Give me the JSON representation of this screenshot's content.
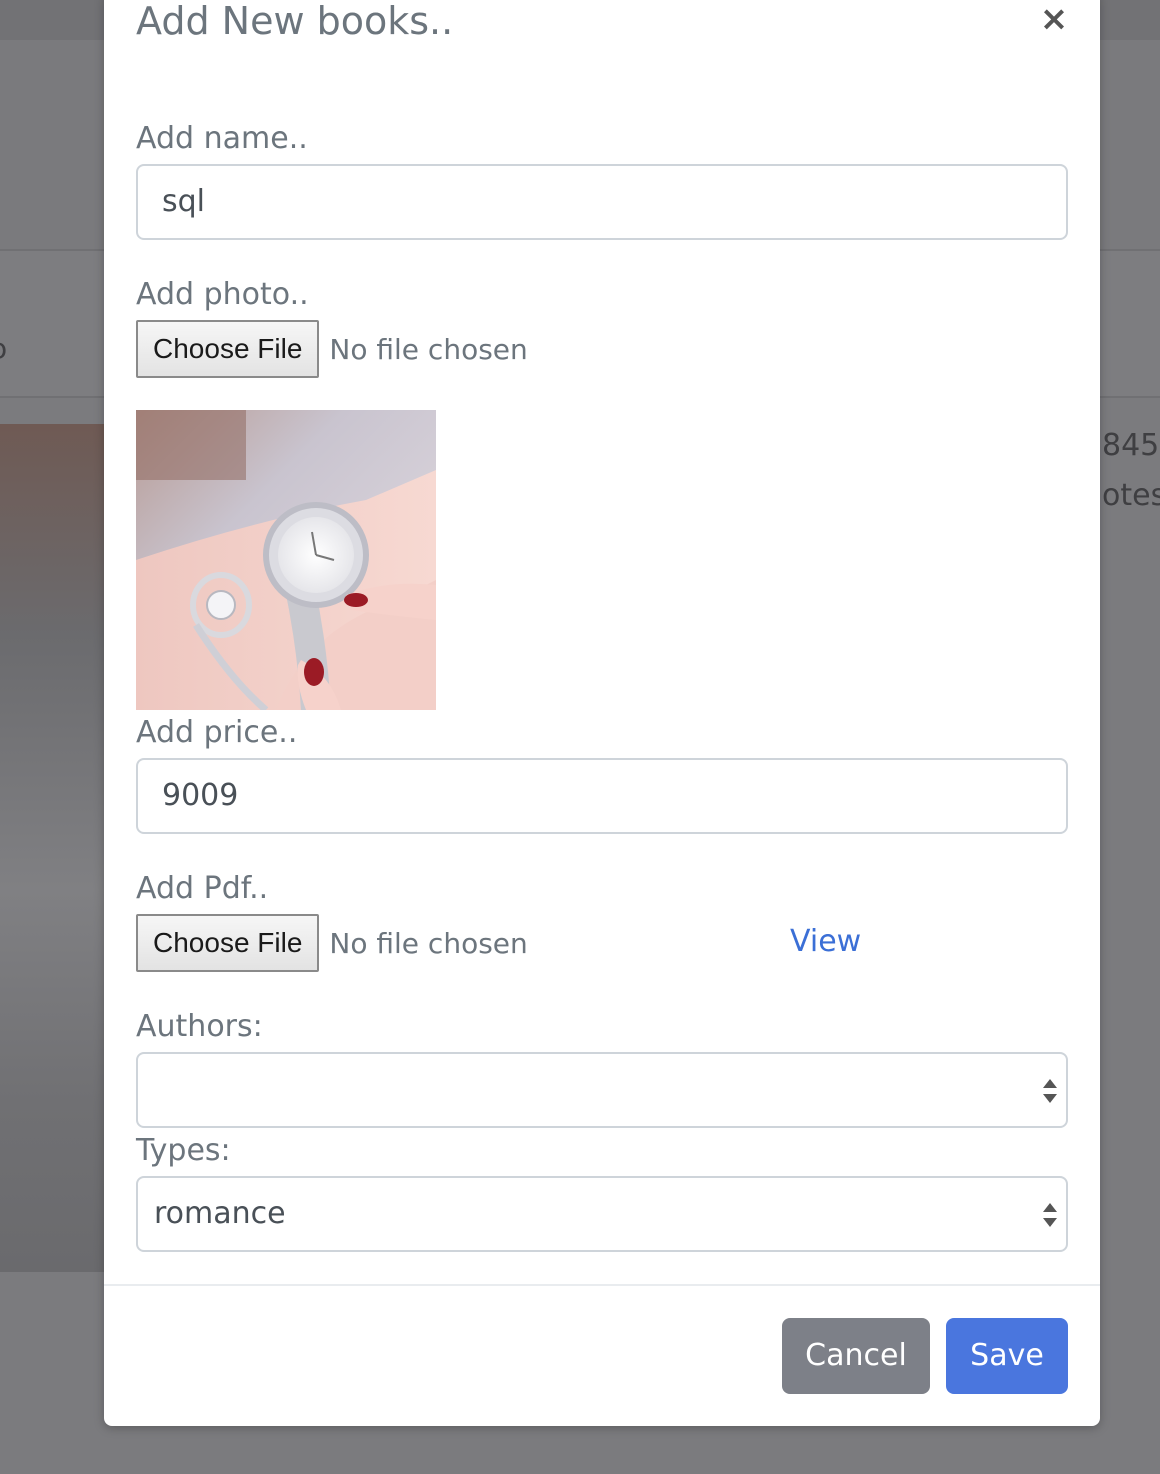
{
  "background": {
    "text_line1": "845",
    "text_line2": "otes",
    "stub": "o"
  },
  "modal": {
    "title": "Add New books..",
    "close_symbol": "×",
    "name": {
      "label": "Add name..",
      "value": "sql"
    },
    "photo": {
      "label": "Add photo..",
      "button_label": "Choose File",
      "status": "No file chosen"
    },
    "price": {
      "label": "Add price..",
      "value": "9009"
    },
    "pdf": {
      "label": "Add Pdf..",
      "button_label": "Choose File",
      "status": "No file chosen",
      "view_link": "View"
    },
    "authors": {
      "label": "Authors:",
      "selected": ""
    },
    "types": {
      "label": "Types:",
      "selected": "romance"
    },
    "footer": {
      "cancel_label": "Cancel",
      "save_label": "Save"
    }
  },
  "colors": {
    "primary": "#4a76de",
    "secondary": "#7d8088",
    "link": "#3b6fd6",
    "overlay": "#7b7b7e"
  }
}
